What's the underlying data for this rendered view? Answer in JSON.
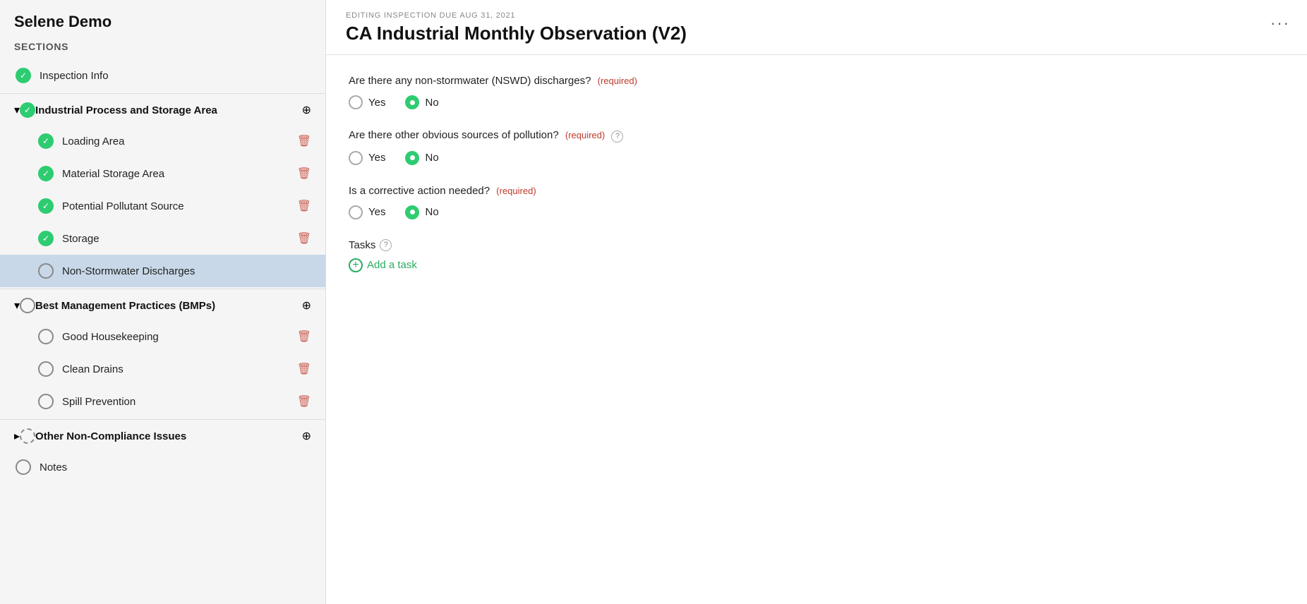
{
  "app": {
    "title": "Selene Demo"
  },
  "sidebar": {
    "sections_label": "Sections",
    "items": [
      {
        "id": "inspection-info",
        "label": "Inspection Info",
        "icon": "check-green",
        "level": "top",
        "active": false
      },
      {
        "id": "industrial-process",
        "label": "Industrial Process and Storage Area",
        "icon": "check-green",
        "level": "group",
        "expanded": true,
        "active": false
      },
      {
        "id": "loading-area",
        "label": "Loading Area",
        "icon": "check-green",
        "level": "sub",
        "active": false
      },
      {
        "id": "material-storage",
        "label": "Material Storage Area",
        "icon": "check-green",
        "level": "sub",
        "active": false
      },
      {
        "id": "potential-pollutant",
        "label": "Potential Pollutant Source",
        "icon": "check-green",
        "level": "sub",
        "active": false
      },
      {
        "id": "storage",
        "label": "Storage",
        "icon": "check-green",
        "level": "sub",
        "active": false
      },
      {
        "id": "non-stormwater",
        "label": "Non-Stormwater Discharges",
        "icon": "circle-empty",
        "level": "sub",
        "active": true
      },
      {
        "id": "bmps",
        "label": "Best Management Practices (BMPs)",
        "icon": "circle-empty",
        "level": "group",
        "expanded": true,
        "active": false
      },
      {
        "id": "good-housekeeping",
        "label": "Good Housekeeping",
        "icon": "circle-empty",
        "level": "sub",
        "active": false
      },
      {
        "id": "clean-drains",
        "label": "Clean Drains",
        "icon": "circle-empty",
        "level": "sub",
        "active": false
      },
      {
        "id": "spill-prevention",
        "label": "Spill Prevention",
        "icon": "circle-empty",
        "level": "sub",
        "active": false
      },
      {
        "id": "other-non-compliance",
        "label": "Other Non-Compliance Issues",
        "icon": "circle-dashed",
        "level": "group",
        "expanded": false,
        "active": false
      },
      {
        "id": "notes",
        "label": "Notes",
        "icon": "circle-empty",
        "level": "top",
        "active": false
      }
    ]
  },
  "main": {
    "editing_label": "EDITING INSPECTION DUE AUG 31, 2021",
    "page_title": "CA Industrial Monthly Observation (V2)",
    "more_button": "···",
    "questions": [
      {
        "id": "q1",
        "text": "Are there any non-stormwater (NSWD) discharges?",
        "required": true,
        "has_help": false,
        "options": [
          "Yes",
          "No"
        ],
        "selected": "No"
      },
      {
        "id": "q2",
        "text": "Are there other obvious sources of pollution?",
        "required": true,
        "has_help": true,
        "options": [
          "Yes",
          "No"
        ],
        "selected": "No"
      },
      {
        "id": "q3",
        "text": "Is a corrective action needed?",
        "required": true,
        "has_help": false,
        "options": [
          "Yes",
          "No"
        ],
        "selected": "No"
      }
    ],
    "tasks": {
      "label": "Tasks",
      "has_help": true,
      "add_label": "Add a task"
    },
    "required_text": "(required)",
    "help_icon_char": "?"
  }
}
